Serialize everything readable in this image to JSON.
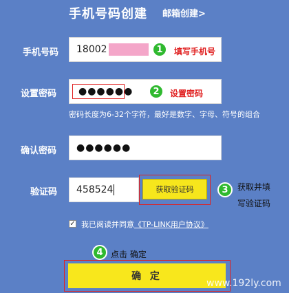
{
  "header": {
    "title": "手机号码创建",
    "switch_link": "邮箱创建>"
  },
  "phone": {
    "label": "手机号码",
    "value": "18002",
    "step": "1",
    "annotation": "填写手机号"
  },
  "password": {
    "label": "设置密码",
    "value": "●●●●●●",
    "step": "2",
    "annotation": "设置密码",
    "hint": "密码长度为6-32个字符，最好是数字、字母、符号的组合"
  },
  "confirm_password": {
    "label": "确认密码",
    "value": "●●●●●●"
  },
  "captcha": {
    "label": "验证码",
    "value": "458524",
    "button": "获取验证码",
    "step": "3",
    "annotation_line1": "获取并填",
    "annotation_line2": "写验证码"
  },
  "agreement": {
    "checkbox_mark": "✓",
    "text": "我已阅读并同意",
    "link": "《TP-LINK用户协议》"
  },
  "submit": {
    "step": "4",
    "annotation": "点击 确定",
    "button": "确 定"
  },
  "watermark": "www.192ly.com",
  "colors": {
    "background": "#5b80c6",
    "accent_yellow": "#f8e71c",
    "badge_green": "#2fb92f",
    "annotation_red": "#e02020"
  }
}
